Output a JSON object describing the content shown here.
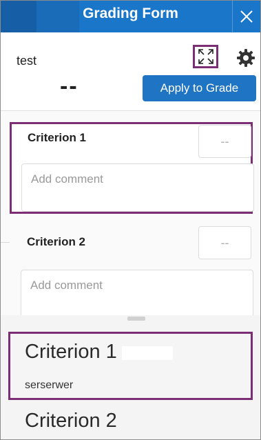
{
  "header": {
    "title": "Grading Form",
    "close_icon": "close-icon"
  },
  "score": {
    "label": "test",
    "value": "--",
    "apply_label": "Apply to Grade",
    "expand_icon": "expand-icon",
    "settings_icon": "gear-icon"
  },
  "criteria": [
    {
      "title": "Criterion 1",
      "score": "--",
      "comment_placeholder": "Add comment"
    },
    {
      "title": "Criterion 2",
      "score": "--",
      "comment_placeholder": "Add comment"
    }
  ],
  "summary": [
    {
      "title": "Criterion 1",
      "text": "serserwer"
    },
    {
      "title": "Criterion 2"
    }
  ],
  "colors": {
    "header": "#1976c9",
    "accent_button": "#1f74c3",
    "highlight_border": "#7c2e74"
  }
}
